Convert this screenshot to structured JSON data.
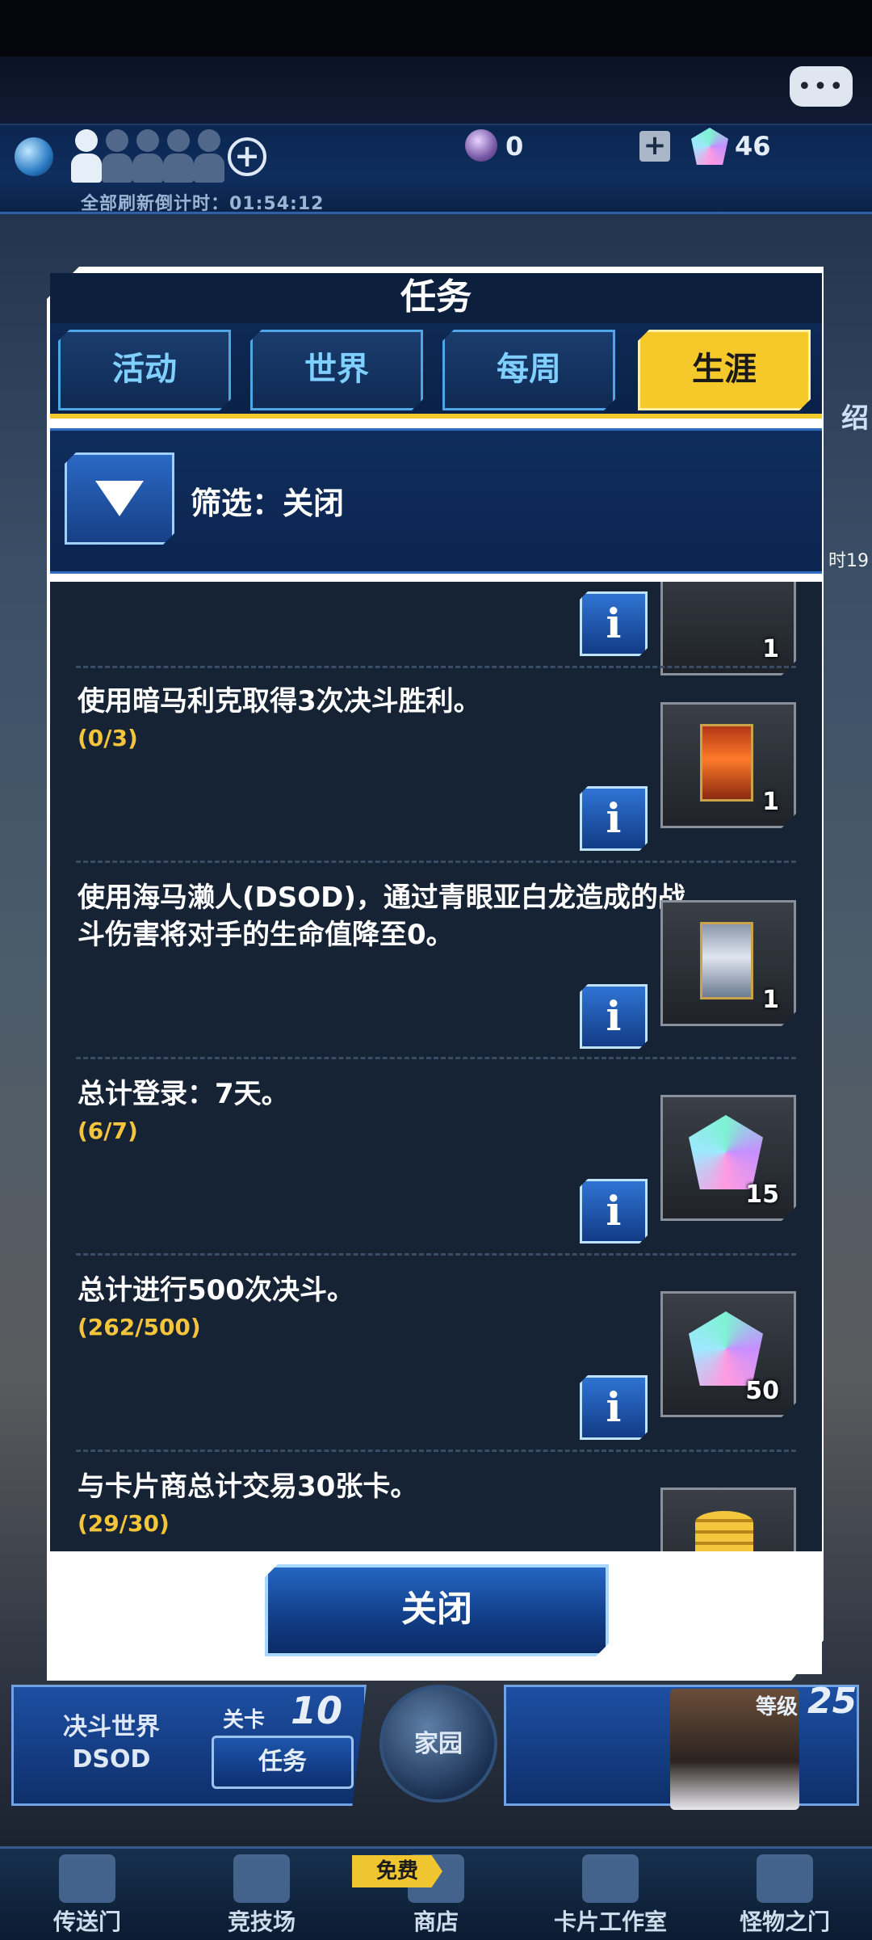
{
  "hud": {
    "refresh_countdown": "全部刷新倒计时：01:54:12",
    "orb_count": "0",
    "gem_count": "46",
    "chat_icon": "chat-bubble-icon"
  },
  "side": {
    "right_label": "绍",
    "right_time": "时19"
  },
  "dialog": {
    "title": "任务",
    "tabs": [
      {
        "label": "活动",
        "active": false
      },
      {
        "label": "世界",
        "active": false
      },
      {
        "label": "每周",
        "active": false
      },
      {
        "label": "生涯",
        "active": true
      }
    ],
    "filter_label": "筛选：关闭",
    "close_label": "关闭"
  },
  "missions": [
    {
      "description": "",
      "progress": "",
      "reward_qty": "1",
      "reward_type": "card"
    },
    {
      "description": "使用暗马利克取得3次决斗胜利。",
      "progress": "(0/3)",
      "reward_qty": "1",
      "reward_type": "card-fire"
    },
    {
      "description": "使用海马濑人(DSOD)，通过青眼亚白龙造成的战斗伤害将对手的生命值降至0。",
      "progress": "",
      "reward_qty": "1",
      "reward_type": "card-dragon"
    },
    {
      "description": "总计登录：7天。",
      "progress": "(6/7)",
      "reward_qty": "15",
      "reward_type": "gem"
    },
    {
      "description": "总计进行500次决斗。",
      "progress": "(262/500)",
      "reward_qty": "50",
      "reward_type": "gem"
    },
    {
      "description": "与卡片商总计交易30张卡。",
      "progress": "(29/30)",
      "reward_qty": "",
      "reward_type": "gold"
    }
  ],
  "bottom_hud": {
    "duel_world": "决斗世界\nDSOD",
    "stage_label": "关卡",
    "stage_number": "10",
    "task_button": "任务",
    "home": "家园",
    "level_label": "等级",
    "level_number": "25"
  },
  "nav": [
    {
      "label": "传送门"
    },
    {
      "label": "竞技场"
    },
    {
      "label": "商店",
      "badge": "免费"
    },
    {
      "label": "卡片工作室"
    },
    {
      "label": "怪物之门"
    }
  ]
}
